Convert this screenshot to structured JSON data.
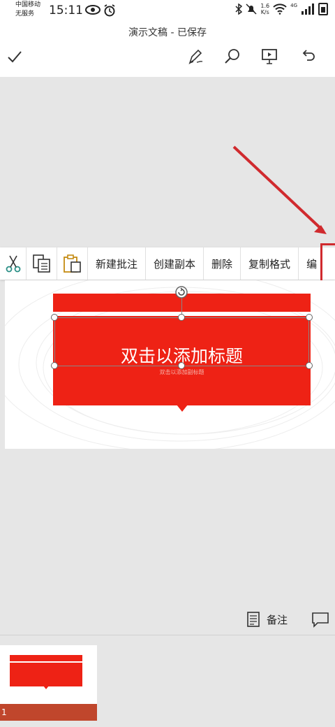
{
  "status_bar": {
    "carrier_line1": "中国移动",
    "carrier_line2": "无服务",
    "time": "15:11",
    "net_speed_value": "1.6",
    "net_speed_unit": "K/s",
    "signal_label": "4G"
  },
  "app_bar": {
    "title": "演示文稿 - 已保存",
    "icons": [
      "check-icon",
      "pen-icon",
      "search-icon",
      "present-icon",
      "undo-icon"
    ]
  },
  "context_menu": {
    "icons": [
      "scissors-icon",
      "copy-icon",
      "paste-icon"
    ],
    "items": [
      "新建批注",
      "创建副本",
      "删除",
      "复制格式",
      "编"
    ]
  },
  "slide": {
    "title_placeholder": "双击以添加标题",
    "subtitle_placeholder": "双击以添加副标题"
  },
  "bottom_bar": {
    "notes_label": "备注"
  },
  "thumbnails": [
    {
      "number": "1"
    }
  ],
  "colors": {
    "accent_red": "#ee2215",
    "annotation_red": "#d02a2e",
    "thumb_footer": "#c0462c",
    "canvas_bg": "#e6e6e6"
  }
}
